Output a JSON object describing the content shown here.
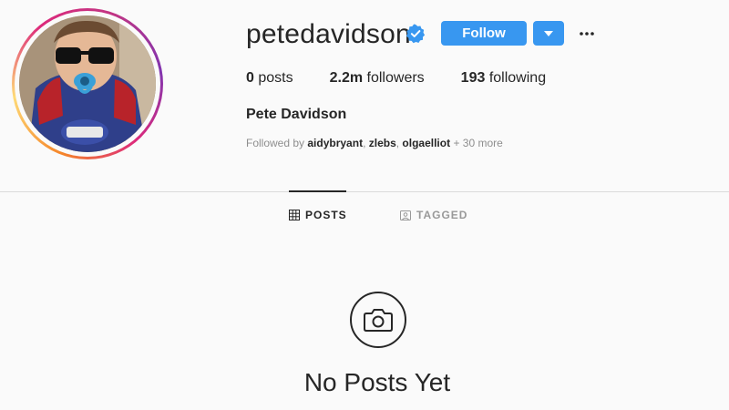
{
  "profile": {
    "username": "petedavidson",
    "full_name": "Pete Davidson",
    "verified": true
  },
  "actions": {
    "follow_label": "Follow",
    "more_label": "•••"
  },
  "stats": {
    "posts_count": "0",
    "posts_label": "posts",
    "followers_count": "2.2m",
    "followers_label": "followers",
    "following_count": "193",
    "following_label": "following"
  },
  "followed_by": {
    "prefix": "Followed by",
    "users": [
      "aidybryant",
      "zlebs",
      "olgaelliot"
    ],
    "suffix": "+ 30 more"
  },
  "tabs": [
    {
      "label": "POSTS",
      "icon": "grid-icon",
      "active": true
    },
    {
      "label": "TAGGED",
      "icon": "tagged-icon",
      "active": false
    }
  ],
  "empty_state": {
    "icon": "camera-icon",
    "title": "No Posts Yet"
  },
  "colors": {
    "accent": "#3897f0",
    "verified": "#3897f0",
    "background": "#fafafa",
    "muted_text": "#8e8e8e"
  }
}
